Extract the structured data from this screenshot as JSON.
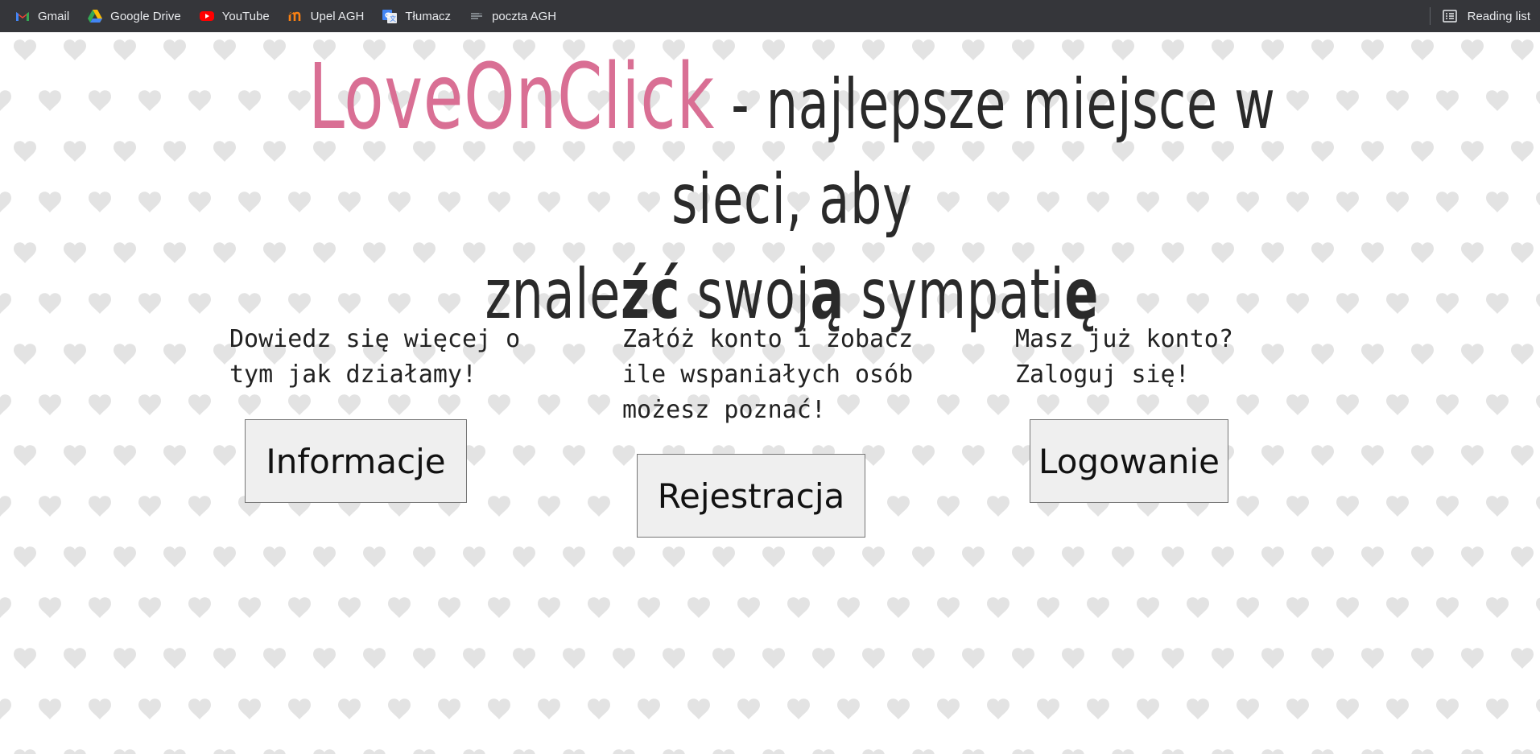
{
  "bookmarks": [
    {
      "label": "Gmail",
      "icon": "gmail-icon"
    },
    {
      "label": "Google Drive",
      "icon": "google-drive-icon"
    },
    {
      "label": "YouTube",
      "icon": "youtube-icon"
    },
    {
      "label": "Upel AGH",
      "icon": "moodle-icon"
    },
    {
      "label": "Tłumacz",
      "icon": "google-translate-icon"
    },
    {
      "label": "poczta AGH",
      "icon": "mail-lines-icon"
    }
  ],
  "reading_list": {
    "label": "Reading list",
    "icon": "reading-list-icon"
  },
  "headline": {
    "brand": "LoveOnClick",
    "part1": " - najlepsze miejsce w sieci, aby",
    "part2a": "znale",
    "part2b": "źć",
    "part2c": " swoj",
    "part2d": "ą",
    "part2e": " sympati",
    "part2f": "ę"
  },
  "sections": {
    "info": {
      "text": "Dowiedz się więcej o tym jak działamy!",
      "button": "Informacje"
    },
    "register": {
      "text": "Załóż konto i zobacz ile wspaniałych osób możesz poznać!",
      "button": "Rejestracja"
    },
    "login": {
      "text": "Masz już konto? Zaloguj się!",
      "button": "Logowanie"
    }
  },
  "colors": {
    "brand": "#d96f94",
    "bar": "#35363a",
    "heart": "#e3e3e3"
  }
}
